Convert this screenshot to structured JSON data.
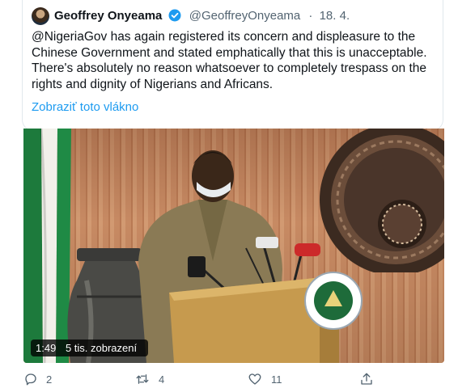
{
  "tweet": {
    "author_name": "Geoffrey Onyeama",
    "handle": "@GeoffreyOnyeama",
    "separator": "·",
    "date": "18. 4.",
    "text": "@NigeriaGov has again registered its concern and displeasure to the Chinese Government and stated emphatically that this is unacceptable. There's absolutely no reason whatsoever to completely trespass on the rights and dignity of Nigerians and Africans.",
    "show_thread": "Zobraziť toto vlákno",
    "colors": {
      "link": "#1d9bf0",
      "verified": "#1d9bf0",
      "muted": "#536471"
    }
  },
  "video": {
    "duration": "1:49",
    "views": "5 tis. zobrazení"
  },
  "actions": {
    "reply_count": "2",
    "retweet_count": "4",
    "like_count": "11",
    "icons": [
      "reply-icon",
      "retweet-icon",
      "like-icon",
      "share-icon"
    ]
  }
}
